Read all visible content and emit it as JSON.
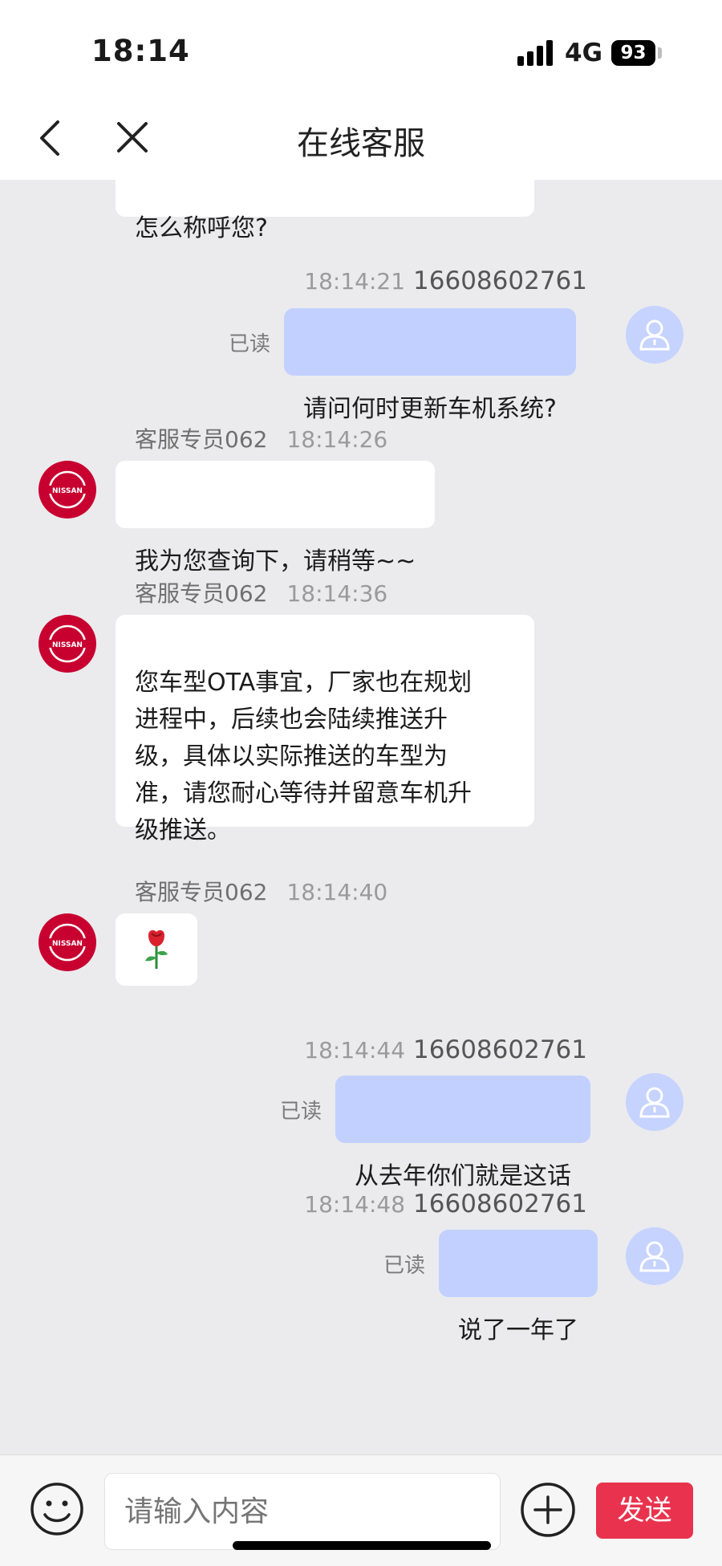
{
  "status_bar": {
    "time": "18:14",
    "network": "4G",
    "battery": "93"
  },
  "nav": {
    "title": "在线客服"
  },
  "messages": [
    {
      "type": "agent_partial",
      "text": "怎么称呼您?"
    },
    {
      "type": "user",
      "time": "18:14:21",
      "phone": "16608602761",
      "read": "已读",
      "text": "请问何时更新车机系统?"
    },
    {
      "type": "agent",
      "name": "客服专员062",
      "time": "18:14:26",
      "text": "我为您查询下，请稍等~~"
    },
    {
      "type": "agent",
      "name": "客服专员062",
      "time": "18:14:36",
      "text": "您车型OTA事宜，厂家也在规划\n进程中，后续也会陆续推送升\n级，具体以实际推送的车型为\n准，请您耐心等待并留意车机升\n级推送。"
    },
    {
      "type": "agent",
      "name": "客服专员062",
      "time": "18:14:40",
      "text": "🌹"
    },
    {
      "type": "user",
      "time": "18:14:44",
      "phone": "16608602761",
      "read": "已读",
      "text": "从去年你们就是这话"
    },
    {
      "type": "user",
      "time": "18:14:48",
      "phone": "16608602761",
      "read": "已读",
      "text": "说了一年了"
    }
  ],
  "agent_avatar_text": "NISSAN",
  "input": {
    "placeholder": "请输入内容",
    "send_label": "发送"
  },
  "colors": {
    "send_button": "#e9334e",
    "user_bubble": "#c1d0ff",
    "agent_avatar": "#c8002f"
  }
}
